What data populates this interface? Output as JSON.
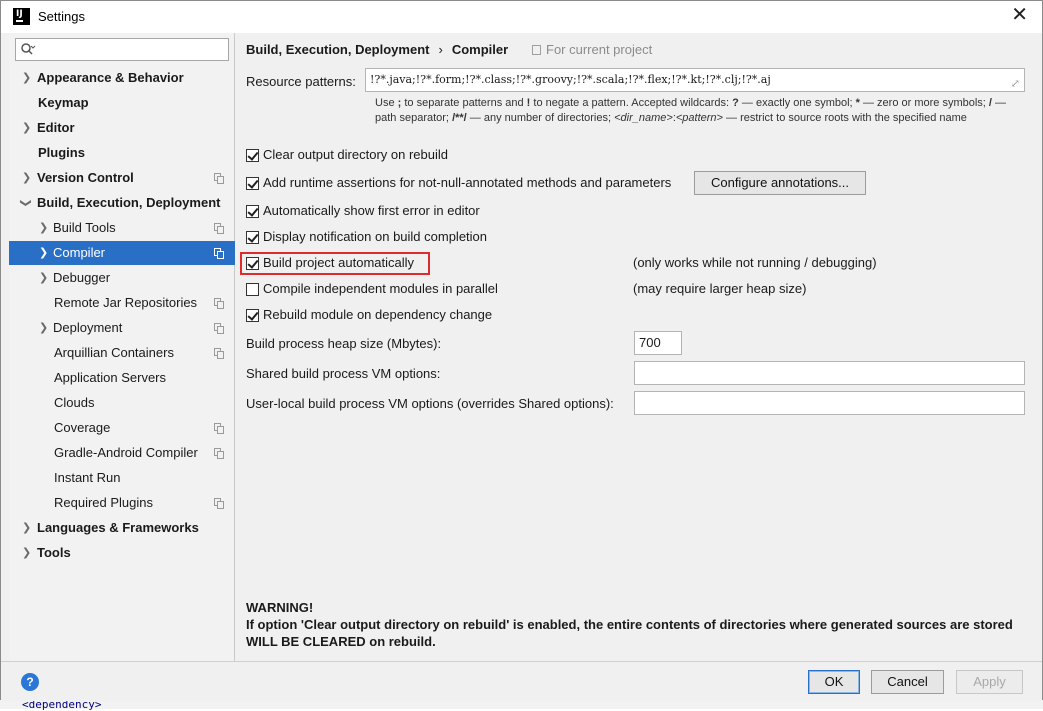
{
  "window": {
    "title": "Settings",
    "app_icon_text": "IJ"
  },
  "sidebar": {
    "search_placeholder": "",
    "items": [
      {
        "label": "Appearance & Behavior"
      },
      {
        "label": "Keymap"
      },
      {
        "label": "Editor"
      },
      {
        "label": "Plugins"
      },
      {
        "label": "Version Control"
      },
      {
        "label": "Build, Execution, Deployment"
      },
      {
        "label": "Build Tools"
      },
      {
        "label": "Compiler"
      },
      {
        "label": "Debugger"
      },
      {
        "label": "Remote Jar Repositories"
      },
      {
        "label": "Deployment"
      },
      {
        "label": "Arquillian Containers"
      },
      {
        "label": "Application Servers"
      },
      {
        "label": "Clouds"
      },
      {
        "label": "Coverage"
      },
      {
        "label": "Gradle-Android Compiler"
      },
      {
        "label": "Instant Run"
      },
      {
        "label": "Required Plugins"
      },
      {
        "label": "Languages & Frameworks"
      },
      {
        "label": "Tools"
      }
    ]
  },
  "content": {
    "breadcrumb": {
      "parent": "Build, Execution, Deployment",
      "separator": "›",
      "current": "Compiler"
    },
    "scope_note": "For current project",
    "resource_patterns": {
      "label": "Resource patterns:",
      "value": "!?*.java;!?*.form;!?*.class;!?*.groovy;!?*.scala;!?*.flex;!?*.kt;!?*.clj;!?*.aj"
    },
    "hint": {
      "p1": "Use ",
      "semicolon": ";",
      "p2": " to separate patterns and ",
      "bang": "!",
      "p3": " to negate a pattern. Accepted wildcards: ",
      "q": "?",
      "p4": " — exactly one symbol; ",
      "star": "*",
      "p5": " — zero or more symbols; ",
      "slash": "/",
      "p6": " — path separator; ",
      "dstar": "/**/",
      "p7": " — any number of directories; ",
      "dir": "<dir_name>",
      "colon": ":",
      "pattern": "<pattern>",
      "p8": " — restrict to source roots with the specified name"
    },
    "options": {
      "clear_output": {
        "label": "Clear output directory on rebuild",
        "checked": true
      },
      "runtime_assertions": {
        "label": "Add runtime assertions for not-null-annotated methods and parameters",
        "checked": true
      },
      "configure_annotations": "Configure annotations...",
      "show_first_error": {
        "label": "Automatically show first error in editor",
        "checked": true
      },
      "display_notification": {
        "label": "Display notification on build completion",
        "checked": true
      },
      "build_automatically": {
        "label": "Build project automatically",
        "checked": true,
        "note": "(only works while not running / debugging)"
      },
      "compile_parallel": {
        "label": "Compile independent modules in parallel",
        "checked": false,
        "note": "(may require larger heap size)"
      },
      "rebuild_on_dependency": {
        "label": "Rebuild module on dependency change",
        "checked": true
      }
    },
    "heap_size": {
      "label": "Build process heap size (Mbytes):",
      "value": "700"
    },
    "shared_vm": {
      "label": "Shared build process VM options:",
      "value": ""
    },
    "user_vm": {
      "label": "User-local build process VM options (overrides Shared options):",
      "value": ""
    },
    "warning": {
      "title": "WARNING!",
      "line1": "If option 'Clear output directory on rebuild' is enabled, the entire contents of directories where generated sources are stored",
      "line2": "WILL BE CLEARED on rebuild."
    }
  },
  "footer": {
    "help": "?",
    "ok": "OK",
    "cancel": "Cancel",
    "apply": "Apply"
  },
  "background": {
    "code_snippet": "<dependency>"
  },
  "colors": {
    "selection": "#2a6fc6",
    "highlight": "#e02b2b",
    "help": "#2a77d6"
  }
}
